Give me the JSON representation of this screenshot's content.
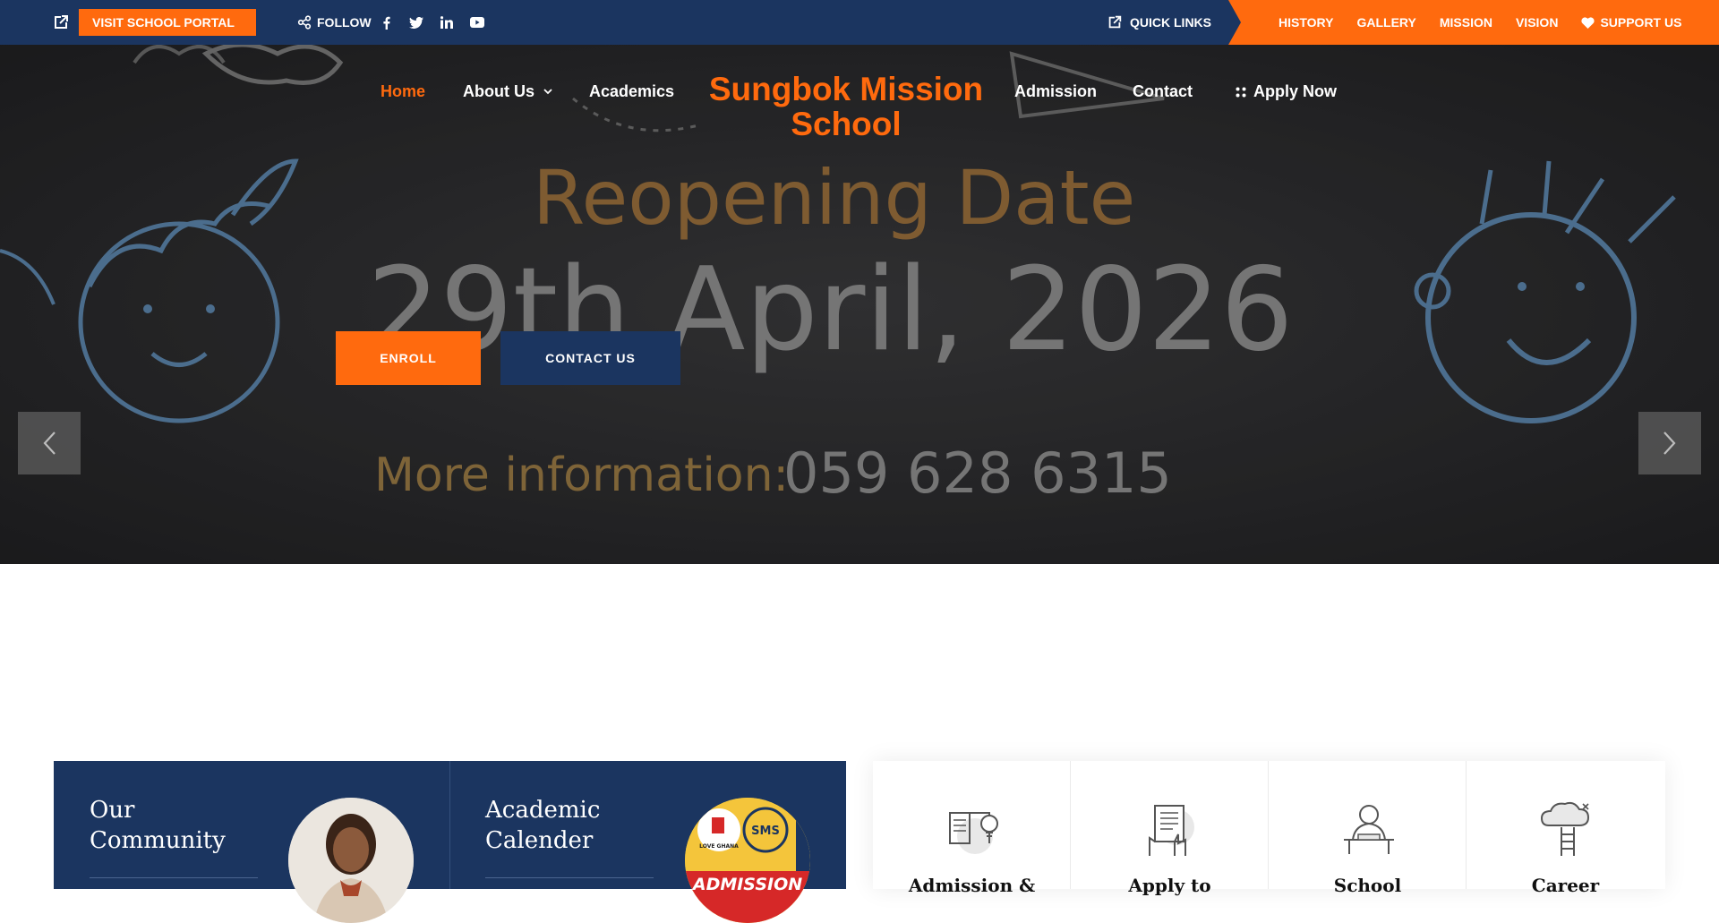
{
  "topbar": {
    "portal_label": "VISIT SCHOOL PORTAL",
    "follow_label": "FOLLOW",
    "social": [
      "facebook-icon",
      "twitter-icon",
      "linkedin-icon",
      "youtube-icon"
    ],
    "quick_links_label": "QUICK LINKS",
    "links": [
      "HISTORY",
      "GALLERY",
      "MISSION",
      "VISION"
    ],
    "support_label": "SUPPORT US"
  },
  "nav": {
    "items": [
      "Home",
      "About Us",
      "Academics",
      "Admission",
      "Contact",
      "Apply Now"
    ],
    "brand_line1": "Sungbok Mission",
    "brand_line2": "School"
  },
  "hero": {
    "slide_title": "Reopening Date",
    "slide_date": "29th April, 2026",
    "slide_info_label": "More information:",
    "slide_phone": "059 628 6315",
    "enroll_label": "ENROLL",
    "contact_label": "CONTACT US"
  },
  "community": {
    "title_line1": "Our",
    "title_line2": "Community"
  },
  "calendar": {
    "title_line1": "Academic",
    "title_line2": "Calender",
    "badge_sms": "SMS",
    "badge_love": "LOVE GHANA",
    "badge_admission": "ADMISSION"
  },
  "cards": [
    {
      "label": "Admission &",
      "icon": "book-bulb-icon"
    },
    {
      "label": "Apply to",
      "icon": "form-hand-icon"
    },
    {
      "label": "School",
      "icon": "teacher-desk-icon"
    },
    {
      "label": "Career",
      "icon": "cloud-ladder-icon"
    }
  ],
  "colors": {
    "navy": "#1b3560",
    "orange": "#ff6a0e"
  }
}
